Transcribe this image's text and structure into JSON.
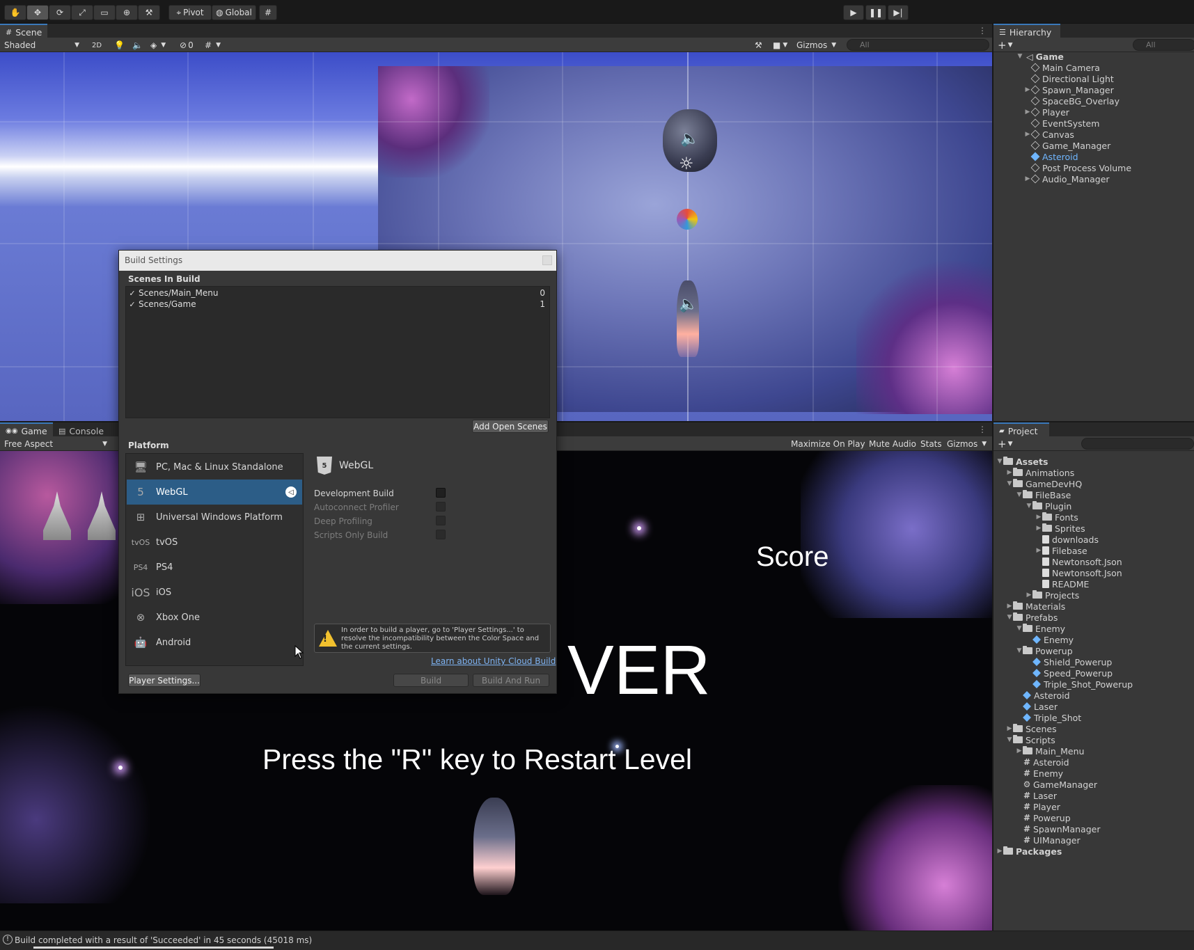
{
  "toolbar": {
    "pivot_label": "Pivot",
    "global_label": "Global"
  },
  "scene_panel": {
    "tab_label": "Scene",
    "shading_mode": "Shaded",
    "mode_2d": "2D",
    "hidden_count": "0",
    "gizmos_label": "Gizmos",
    "search_placeholder": "All"
  },
  "hierarchy": {
    "tab_label": "Hierarchy",
    "search_placeholder": "All",
    "scene_name": "Game",
    "items": [
      {
        "label": "Main Camera",
        "expandable": false,
        "selected": false
      },
      {
        "label": "Directional Light",
        "expandable": false,
        "selected": false
      },
      {
        "label": "Spawn_Manager",
        "expandable": true,
        "selected": false
      },
      {
        "label": "SpaceBG_Overlay",
        "expandable": false,
        "selected": false
      },
      {
        "label": "Player",
        "expandable": true,
        "selected": false
      },
      {
        "label": "EventSystem",
        "expandable": false,
        "selected": false
      },
      {
        "label": "Canvas",
        "expandable": true,
        "selected": false
      },
      {
        "label": "Game_Manager",
        "expandable": false,
        "selected": false
      },
      {
        "label": "Asteroid",
        "expandable": false,
        "selected": true
      },
      {
        "label": "Post Process Volume",
        "expandable": false,
        "selected": false
      },
      {
        "label": "Audio_Manager",
        "expandable": true,
        "selected": false
      }
    ]
  },
  "game_panel": {
    "tab_game": "Game",
    "tab_console": "Console",
    "aspect": "Free Aspect",
    "maximize_on_play": "Maximize On Play",
    "mute_audio": "Mute Audio",
    "stats": "Stats",
    "gizmos": "Gizmos",
    "score_text": "Score",
    "game_over_text": "VER",
    "restart_text": "Press the \"R\" key to Restart Level"
  },
  "project": {
    "tab_label": "Project",
    "tree": [
      {
        "label": "Assets",
        "depth": 0,
        "kind": "folder",
        "open": true,
        "bold": true
      },
      {
        "label": "Animations",
        "depth": 1,
        "kind": "folder",
        "arrow": "closed"
      },
      {
        "label": "GameDevHQ",
        "depth": 1,
        "kind": "folder",
        "arrow": "open"
      },
      {
        "label": "FileBase",
        "depth": 2,
        "kind": "folder",
        "arrow": "open"
      },
      {
        "label": "Plugin",
        "depth": 3,
        "kind": "folder",
        "arrow": "open"
      },
      {
        "label": "Fonts",
        "depth": 4,
        "kind": "folder",
        "arrow": "closed"
      },
      {
        "label": "Sprites",
        "depth": 4,
        "kind": "folder",
        "arrow": "closed"
      },
      {
        "label": "downloads",
        "depth": 4,
        "kind": "doc",
        "arrow": "none"
      },
      {
        "label": "Filebase",
        "depth": 4,
        "kind": "doc",
        "arrow": "closed"
      },
      {
        "label": "Newtonsoft.Json",
        "depth": 4,
        "kind": "doc",
        "arrow": "none"
      },
      {
        "label": "Newtonsoft.Json",
        "depth": 4,
        "kind": "doc",
        "arrow": "none"
      },
      {
        "label": "README",
        "depth": 4,
        "kind": "doc",
        "arrow": "none"
      },
      {
        "label": "Projects",
        "depth": 3,
        "kind": "folder",
        "arrow": "closed"
      },
      {
        "label": "Materials",
        "depth": 1,
        "kind": "folder",
        "arrow": "closed"
      },
      {
        "label": "Prefabs",
        "depth": 1,
        "kind": "folder",
        "arrow": "open"
      },
      {
        "label": "Enemy",
        "depth": 2,
        "kind": "folder",
        "arrow": "open"
      },
      {
        "label": "Enemy",
        "depth": 3,
        "kind": "prefab",
        "arrow": "none"
      },
      {
        "label": "Powerup",
        "depth": 2,
        "kind": "folder",
        "arrow": "open"
      },
      {
        "label": "Shield_Powerup",
        "depth": 3,
        "kind": "prefab",
        "arrow": "none"
      },
      {
        "label": "Speed_Powerup",
        "depth": 3,
        "kind": "prefab",
        "arrow": "none"
      },
      {
        "label": "Triple_Shot_Powerup",
        "depth": 3,
        "kind": "prefab",
        "arrow": "none"
      },
      {
        "label": "Asteroid",
        "depth": 2,
        "kind": "prefab",
        "arrow": "none"
      },
      {
        "label": "Laser",
        "depth": 2,
        "kind": "prefab",
        "arrow": "none"
      },
      {
        "label": "Triple_Shot",
        "depth": 2,
        "kind": "prefab",
        "arrow": "none"
      },
      {
        "label": "Scenes",
        "depth": 1,
        "kind": "folder",
        "arrow": "closed"
      },
      {
        "label": "Scripts",
        "depth": 1,
        "kind": "folder",
        "arrow": "open"
      },
      {
        "label": "Main_Menu",
        "depth": 2,
        "kind": "folder",
        "arrow": "closed"
      },
      {
        "label": "Asteroid",
        "depth": 2,
        "kind": "script",
        "arrow": "none"
      },
      {
        "label": "Enemy",
        "depth": 2,
        "kind": "script",
        "arrow": "none"
      },
      {
        "label": "GameManager",
        "depth": 2,
        "kind": "gear",
        "arrow": "none"
      },
      {
        "label": "Laser",
        "depth": 2,
        "kind": "script",
        "arrow": "none"
      },
      {
        "label": "Player",
        "depth": 2,
        "kind": "script",
        "arrow": "none"
      },
      {
        "label": "Powerup",
        "depth": 2,
        "kind": "script",
        "arrow": "none"
      },
      {
        "label": "SpawnManager",
        "depth": 2,
        "kind": "script",
        "arrow": "none"
      },
      {
        "label": "UIManager",
        "depth": 2,
        "kind": "script",
        "arrow": "none"
      },
      {
        "label": "Packages",
        "depth": 0,
        "kind": "folder",
        "arrow": "closed",
        "bold": true
      }
    ]
  },
  "build_settings": {
    "title": "Build Settings",
    "scenes_header": "Scenes In Build",
    "scenes": [
      {
        "name": "Scenes/Main_Menu",
        "index": "0",
        "checked": true
      },
      {
        "name": "Scenes/Game",
        "index": "1",
        "checked": true
      }
    ],
    "add_open_scenes": "Add Open Scenes",
    "platform_header": "Platform",
    "platforms": [
      {
        "label": "PC, Mac & Linux Standalone",
        "icon": "monitor-icon",
        "selected": false
      },
      {
        "label": "WebGL",
        "icon": "html5-icon",
        "selected": true
      },
      {
        "label": "Universal Windows Platform",
        "icon": "windows-icon",
        "selected": false
      },
      {
        "label": "tvOS",
        "icon": "tvos-icon",
        "selected": false
      },
      {
        "label": "PS4",
        "icon": "ps4-icon",
        "selected": false
      },
      {
        "label": "iOS",
        "icon": "ios-icon",
        "selected": false
      },
      {
        "label": "Xbox One",
        "icon": "xbox-icon",
        "selected": false
      },
      {
        "label": "Android",
        "icon": "android-icon",
        "selected": false
      }
    ],
    "selected_platform_title": "WebGL",
    "options": [
      {
        "label": "Development Build",
        "enabled": true,
        "checked": false
      },
      {
        "label": "Autoconnect Profiler",
        "enabled": false,
        "checked": false
      },
      {
        "label": "Deep Profiling",
        "enabled": false,
        "checked": false
      },
      {
        "label": "Scripts Only Build",
        "enabled": false,
        "checked": false
      }
    ],
    "warning": "In order to build a player, go to 'Player Settings...' to resolve the incompatibility between the Color Space and the current settings.",
    "cloud_link": "Learn about Unity Cloud Build",
    "player_settings": "Player Settings...",
    "build": "Build",
    "build_and_run": "Build And Run"
  },
  "status_bar": {
    "message": "Build completed with a result of 'Succeeded' in 45 seconds (45018 ms)"
  },
  "colors": {
    "accent": "#3a79bb",
    "selection": "#2c5d87",
    "link": "#7eb3f2",
    "prefab_blue": "#6fb6ff"
  }
}
